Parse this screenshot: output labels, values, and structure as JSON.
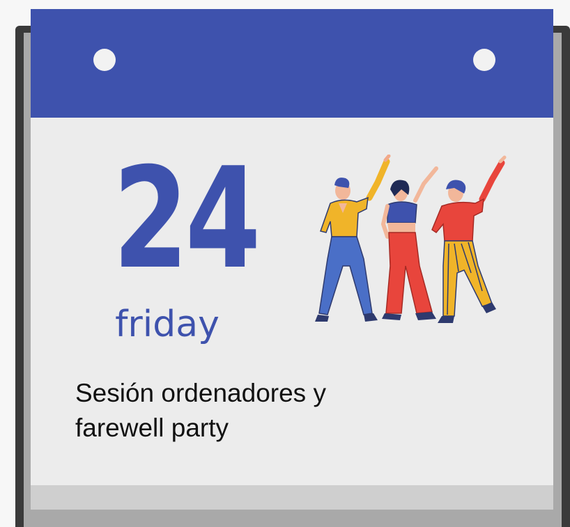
{
  "calendar": {
    "day_number": "24",
    "day_name": "friday",
    "event_line_1": "Sesión ordenadores y",
    "event_line_2": "farewell party",
    "colors": {
      "header": "#3e52ad",
      "page": "#ececec",
      "frame": "#3a3a3a",
      "text_accent": "#3e52ad"
    },
    "illustration": "three-dancers-icon"
  }
}
